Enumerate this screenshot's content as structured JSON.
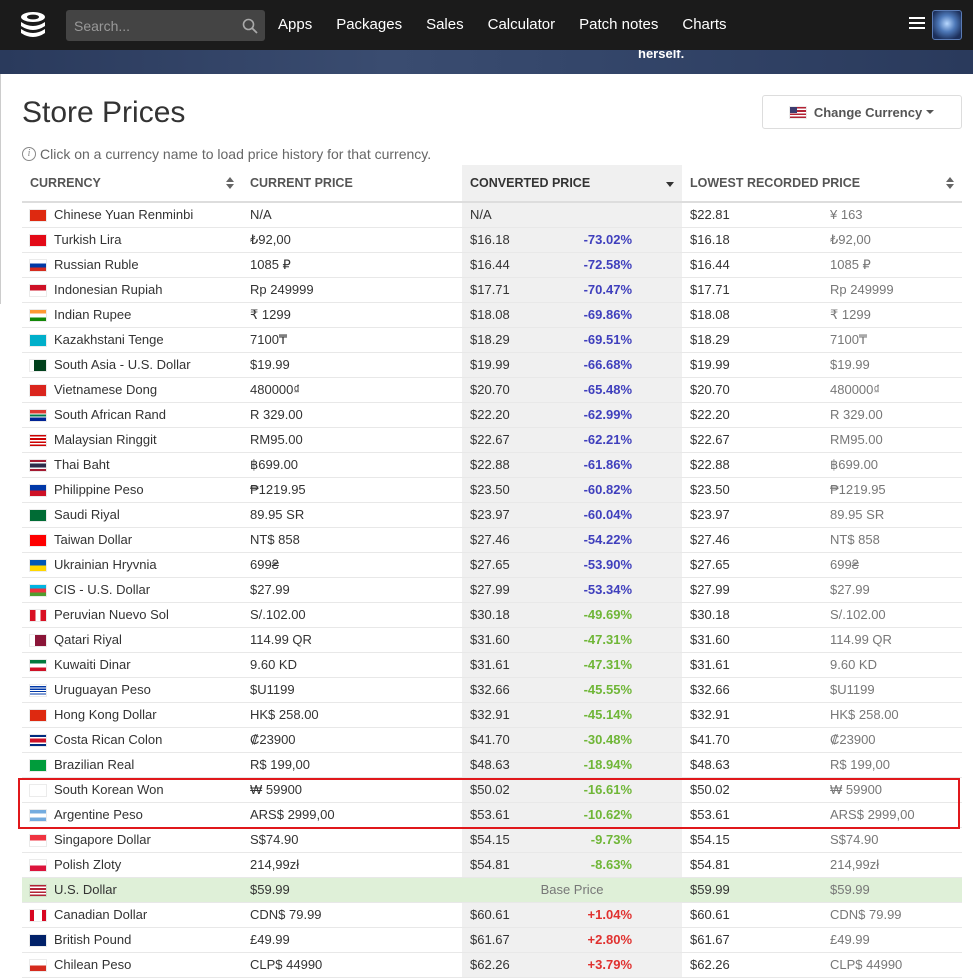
{
  "nav": {
    "search_placeholder": "Search...",
    "links": [
      "Apps",
      "Packages",
      "Sales",
      "Calculator",
      "Patch notes",
      "Charts"
    ]
  },
  "banner": {
    "text": "herself."
  },
  "page": {
    "title": "Store Prices",
    "change_currency": "Change Currency",
    "info": "Click on a currency name to load price history for that currency."
  },
  "table": {
    "headers": {
      "currency": "CURRENCY",
      "current": "CURRENT PRICE",
      "converted": "CONVERTED PRICE",
      "lowest": "LOWEST RECORDED PRICE"
    },
    "base_label": "Base Price",
    "rows": [
      {
        "name": "Chinese Yuan Renminbi",
        "flag": "cn",
        "current": "N/A",
        "converted": "N/A",
        "pct": "",
        "low_usd": "$22.81",
        "low_local": "¥ 163",
        "tone": ""
      },
      {
        "name": "Turkish Lira",
        "flag": "tr",
        "current": "₺92,00",
        "converted": "$16.18",
        "pct": "-73.02%",
        "low_usd": "$16.18",
        "low_local": "₺92,00",
        "tone": "neg-strong"
      },
      {
        "name": "Russian Ruble",
        "flag": "ru",
        "current": "1085 ₽",
        "converted": "$16.44",
        "pct": "-72.58%",
        "low_usd": "$16.44",
        "low_local": "1085 ₽",
        "tone": "neg-strong"
      },
      {
        "name": "Indonesian Rupiah",
        "flag": "id",
        "current": "Rp 249999",
        "converted": "$17.71",
        "pct": "-70.47%",
        "low_usd": "$17.71",
        "low_local": "Rp 249999",
        "tone": "neg-strong"
      },
      {
        "name": "Indian Rupee",
        "flag": "in",
        "current": "₹ 1299",
        "converted": "$18.08",
        "pct": "-69.86%",
        "low_usd": "$18.08",
        "low_local": "₹ 1299",
        "tone": "neg-strong"
      },
      {
        "name": "Kazakhstani Tenge",
        "flag": "kz",
        "current": "7100₸",
        "converted": "$18.29",
        "pct": "-69.51%",
        "low_usd": "$18.29",
        "low_local": "7100₸",
        "tone": "neg-strong"
      },
      {
        "name": "South Asia - U.S. Dollar",
        "flag": "pk",
        "current": "$19.99",
        "converted": "$19.99",
        "pct": "-66.68%",
        "low_usd": "$19.99",
        "low_local": "$19.99",
        "tone": "neg-strong"
      },
      {
        "name": "Vietnamese Dong",
        "flag": "vn",
        "current": "480000₫",
        "converted": "$20.70",
        "pct": "-65.48%",
        "low_usd": "$20.70",
        "low_local": "480000₫",
        "tone": "neg-strong"
      },
      {
        "name": "South African Rand",
        "flag": "za",
        "current": "R 329.00",
        "converted": "$22.20",
        "pct": "-62.99%",
        "low_usd": "$22.20",
        "low_local": "R 329.00",
        "tone": "neg-strong"
      },
      {
        "name": "Malaysian Ringgit",
        "flag": "my",
        "current": "RM95.00",
        "converted": "$22.67",
        "pct": "-62.21%",
        "low_usd": "$22.67",
        "low_local": "RM95.00",
        "tone": "neg-strong"
      },
      {
        "name": "Thai Baht",
        "flag": "th",
        "current": "฿699.00",
        "converted": "$22.88",
        "pct": "-61.86%",
        "low_usd": "$22.88",
        "low_local": "฿699.00",
        "tone": "neg-strong"
      },
      {
        "name": "Philippine Peso",
        "flag": "ph",
        "current": "₱1219.95",
        "converted": "$23.50",
        "pct": "-60.82%",
        "low_usd": "$23.50",
        "low_local": "₱1219.95",
        "tone": "neg-strong"
      },
      {
        "name": "Saudi Riyal",
        "flag": "sa",
        "current": "89.95 SR",
        "converted": "$23.97",
        "pct": "-60.04%",
        "low_usd": "$23.97",
        "low_local": "89.95 SR",
        "tone": "neg-strong"
      },
      {
        "name": "Taiwan Dollar",
        "flag": "tw",
        "current": "NT$ 858",
        "converted": "$27.46",
        "pct": "-54.22%",
        "low_usd": "$27.46",
        "low_local": "NT$ 858",
        "tone": "neg-strong"
      },
      {
        "name": "Ukrainian Hryvnia",
        "flag": "ua",
        "current": "699₴",
        "converted": "$27.65",
        "pct": "-53.90%",
        "low_usd": "$27.65",
        "low_local": "699₴",
        "tone": "neg-strong"
      },
      {
        "name": "CIS - U.S. Dollar",
        "flag": "az",
        "current": "$27.99",
        "converted": "$27.99",
        "pct": "-53.34%",
        "low_usd": "$27.99",
        "low_local": "$27.99",
        "tone": "neg-strong"
      },
      {
        "name": "Peruvian Nuevo Sol",
        "flag": "pe",
        "current": "S/.102.00",
        "converted": "$30.18",
        "pct": "-49.69%",
        "low_usd": "$30.18",
        "low_local": "S/.102.00",
        "tone": "neg-mild"
      },
      {
        "name": "Qatari Riyal",
        "flag": "qa",
        "current": "114.99 QR",
        "converted": "$31.60",
        "pct": "-47.31%",
        "low_usd": "$31.60",
        "low_local": "114.99 QR",
        "tone": "neg-mild"
      },
      {
        "name": "Kuwaiti Dinar",
        "flag": "kw",
        "current": "9.60 KD",
        "converted": "$31.61",
        "pct": "-47.31%",
        "low_usd": "$31.61",
        "low_local": "9.60 KD",
        "tone": "neg-mild"
      },
      {
        "name": "Uruguayan Peso",
        "flag": "uy",
        "current": "$U1199",
        "converted": "$32.66",
        "pct": "-45.55%",
        "low_usd": "$32.66",
        "low_local": "$U1199",
        "tone": "neg-mild"
      },
      {
        "name": "Hong Kong Dollar",
        "flag": "hk",
        "current": "HK$ 258.00",
        "converted": "$32.91",
        "pct": "-45.14%",
        "low_usd": "$32.91",
        "low_local": "HK$ 258.00",
        "tone": "neg-mild"
      },
      {
        "name": "Costa Rican Colon",
        "flag": "cr",
        "current": "₡23900",
        "converted": "$41.70",
        "pct": "-30.48%",
        "low_usd": "$41.70",
        "low_local": "₡23900",
        "tone": "neg-mild"
      },
      {
        "name": "Brazilian Real",
        "flag": "br",
        "current": "R$ 199,00",
        "converted": "$48.63",
        "pct": "-18.94%",
        "low_usd": "$48.63",
        "low_local": "R$ 199,00",
        "tone": "neg-mild"
      },
      {
        "name": "South Korean Won",
        "flag": "kr",
        "current": "₩ 59900",
        "converted": "$50.02",
        "pct": "-16.61%",
        "low_usd": "$50.02",
        "low_local": "₩ 59900",
        "tone": "neg-mild"
      },
      {
        "name": "Argentine Peso",
        "flag": "ar",
        "current": "ARS$ 2999,00",
        "converted": "$53.61",
        "pct": "-10.62%",
        "low_usd": "$53.61",
        "low_local": "ARS$ 2999,00",
        "tone": "neg-mild"
      },
      {
        "name": "Singapore Dollar",
        "flag": "sg",
        "current": "S$74.90",
        "converted": "$54.15",
        "pct": "-9.73%",
        "low_usd": "$54.15",
        "low_local": "S$74.90",
        "tone": "neg-mild"
      },
      {
        "name": "Polish Zloty",
        "flag": "pl",
        "current": "214,99zł",
        "converted": "$54.81",
        "pct": "-8.63%",
        "low_usd": "$54.81",
        "low_local": "214,99zł",
        "tone": "neg-mild"
      },
      {
        "name": "U.S. Dollar",
        "flag": "us",
        "current": "$59.99",
        "converted": "",
        "pct": "",
        "low_usd": "$59.99",
        "low_local": "$59.99",
        "tone": "base"
      },
      {
        "name": "Canadian Dollar",
        "flag": "ca",
        "current": "CDN$ 79.99",
        "converted": "$60.61",
        "pct": "+1.04%",
        "low_usd": "$60.61",
        "low_local": "CDN$ 79.99",
        "tone": "pos"
      },
      {
        "name": "British Pound",
        "flag": "gb",
        "current": "£49.99",
        "converted": "$61.67",
        "pct": "+2.80%",
        "low_usd": "$61.67",
        "low_local": "£49.99",
        "tone": "pos"
      },
      {
        "name": "Chilean Peso",
        "flag": "cl",
        "current": "CLP$ 44990",
        "converted": "$62.26",
        "pct": "+3.79%",
        "low_usd": "$62.26",
        "low_local": "CLP$ 44990",
        "tone": "pos"
      }
    ]
  }
}
